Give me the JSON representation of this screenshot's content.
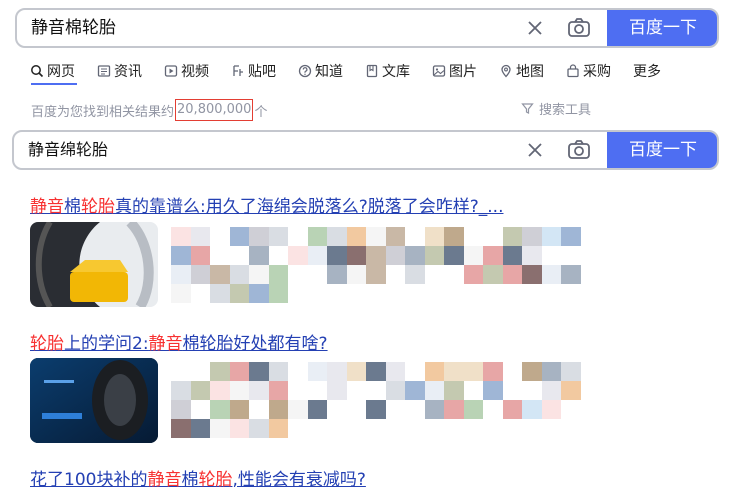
{
  "search": {
    "query": "静音棉轮胎",
    "button": "百度一下",
    "icons": [
      "close-icon",
      "camera-icon"
    ]
  },
  "tabs": [
    {
      "label": "网页",
      "icon": "search-icon",
      "active": true
    },
    {
      "label": "资讯",
      "icon": "news-icon"
    },
    {
      "label": "视频",
      "icon": "video-icon"
    },
    {
      "label": "贴吧",
      "icon": "tieba-icon"
    },
    {
      "label": "知道",
      "icon": "question-icon"
    },
    {
      "label": "文库",
      "icon": "document-icon"
    },
    {
      "label": "图片",
      "icon": "image-icon"
    },
    {
      "label": "地图",
      "icon": "map-icon"
    },
    {
      "label": "采购",
      "icon": "shopping-icon"
    },
    {
      "label": "更多",
      "icon": ""
    }
  ],
  "results_info": {
    "prefix": "百度为您找到相关结果约",
    "count": "20,800,000",
    "suffix": "个",
    "tools": "搜索工具"
  },
  "second_search": {
    "query": "静音绵轮胎",
    "button": "百度一下"
  },
  "results": [
    {
      "parts": [
        [
          "静音",
          true
        ],
        [
          "棉",
          false
        ],
        [
          "轮胎",
          true
        ],
        [
          "真的靠谱么:用久了海绵会脱落么?脱落了会咋样?_...",
          false
        ]
      ]
    },
    {
      "parts": [
        [
          "轮胎",
          true
        ],
        [
          "上的学问2:",
          false
        ],
        [
          "静音",
          true
        ],
        [
          "棉轮胎好处都有啥?",
          false
        ]
      ]
    },
    {
      "parts": [
        [
          "花了100块补的",
          false
        ],
        [
          "静音",
          true
        ],
        [
          "棉",
          false
        ],
        [
          "轮胎",
          true
        ],
        [
          ",性能会有衰减吗?",
          false
        ]
      ]
    }
  ],
  "colors": {
    "accent": "#4e6ef2",
    "link": "#2440b3",
    "highlight": "#f73131",
    "count_box": "#e33e33"
  }
}
